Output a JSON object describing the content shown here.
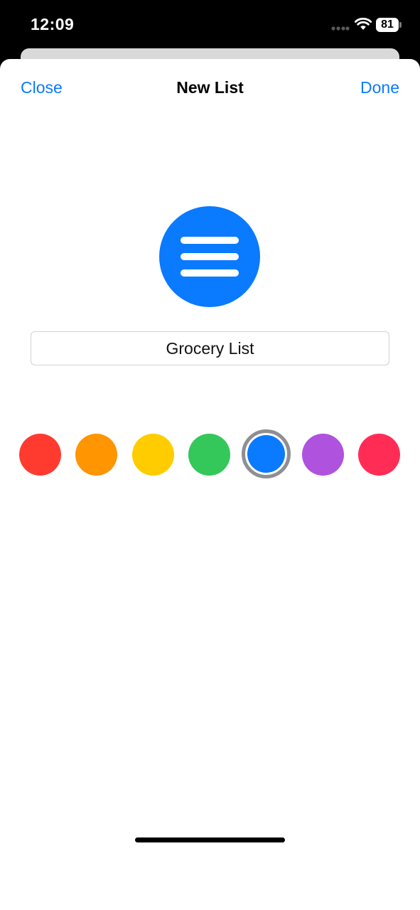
{
  "status_bar": {
    "time": "12:09",
    "battery_level": "81",
    "icons": [
      "cellular-signal-icon",
      "wifi-icon",
      "battery-icon"
    ]
  },
  "nav": {
    "close_label": "Close",
    "title": "New List",
    "done_label": "Done"
  },
  "list_icon": {
    "symbol": "list-bullet-icon",
    "color": "#0a7aff"
  },
  "name_field": {
    "value": "Grocery List"
  },
  "colors": {
    "options": [
      {
        "name": "red",
        "hex": "#ff3b30"
      },
      {
        "name": "orange",
        "hex": "#ff9500"
      },
      {
        "name": "yellow",
        "hex": "#ffcc00"
      },
      {
        "name": "green",
        "hex": "#34c759"
      },
      {
        "name": "blue",
        "hex": "#0a7aff"
      },
      {
        "name": "purple",
        "hex": "#af52de"
      },
      {
        "name": "pink",
        "hex": "#ff2d55"
      }
    ],
    "selected": "blue"
  },
  "accent_color": "#0a7aff"
}
